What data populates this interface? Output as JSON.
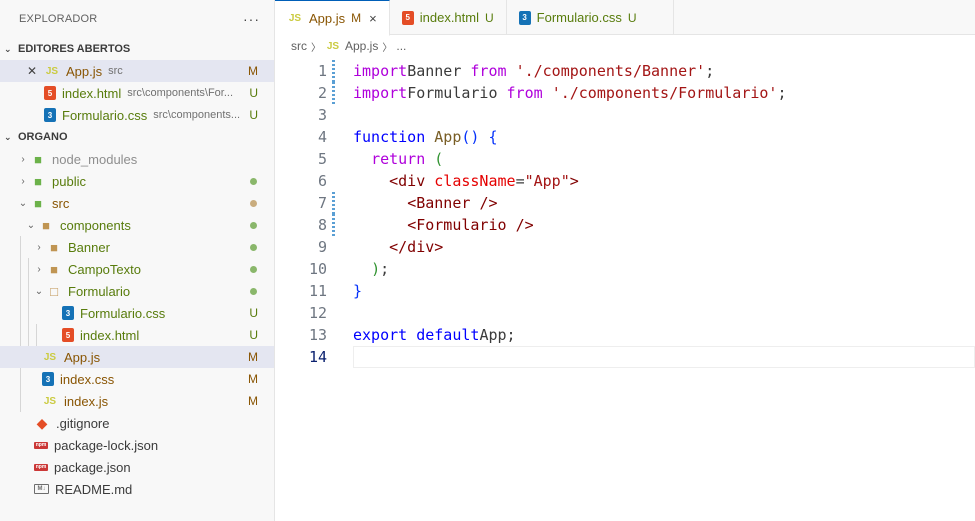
{
  "explorer": {
    "title": "EXPLORADOR",
    "more": "···",
    "open_editors": {
      "title": "EDITORES ABERTOS",
      "items": [
        {
          "name": "App.js",
          "desc": "src",
          "status": "M",
          "icon": "js-icon"
        },
        {
          "name": "index.html",
          "desc": "src\\components\\For...",
          "status": "U",
          "icon": "html-icon"
        },
        {
          "name": "Formulario.css",
          "desc": "src\\components...",
          "status": "U",
          "icon": "css-icon"
        }
      ]
    },
    "project": {
      "title": "ORGANO",
      "tree": [
        {
          "name": "node_modules",
          "kind": "folder"
        },
        {
          "name": "public",
          "kind": "folder"
        },
        {
          "name": "src",
          "kind": "folder"
        },
        {
          "name": "components",
          "kind": "folder"
        },
        {
          "name": "Banner",
          "kind": "folder"
        },
        {
          "name": "CampoTexto",
          "kind": "folder"
        },
        {
          "name": "Formulario",
          "kind": "folder"
        },
        {
          "name": "Formulario.css",
          "kind": "file",
          "status": "U"
        },
        {
          "name": "index.html",
          "kind": "file",
          "status": "U"
        },
        {
          "name": "App.js",
          "kind": "file",
          "status": "M"
        },
        {
          "name": "index.css",
          "kind": "file",
          "status": "M"
        },
        {
          "name": "index.js",
          "kind": "file",
          "status": "M"
        },
        {
          "name": ".gitignore",
          "kind": "file"
        },
        {
          "name": "package-lock.json",
          "kind": "file"
        },
        {
          "name": "package.json",
          "kind": "file"
        },
        {
          "name": "README.md",
          "kind": "file"
        }
      ]
    }
  },
  "tabs": [
    {
      "name": "App.js",
      "status": "M",
      "close": "×",
      "icon": "js-icon"
    },
    {
      "name": "index.html",
      "status": "U",
      "icon": "html-icon"
    },
    {
      "name": "Formulario.css",
      "status": "U",
      "icon": "css-icon"
    }
  ],
  "breadcrumb": {
    "folder": "src",
    "file": "App.js",
    "more": "..."
  },
  "code": {
    "line_numbers": [
      "1",
      "2",
      "3",
      "4",
      "5",
      "6",
      "7",
      "8",
      "9",
      "10",
      "11",
      "12",
      "13",
      "14"
    ],
    "lines": [
      [
        [
          "kw-ctl",
          "import"
        ],
        [
          "",
          "Banner "
        ],
        [
          "kw-ctl",
          "from"
        ],
        [
          "",
          ""
        ],
        [
          "str",
          "'./components/Banner'"
        ],
        [
          "",
          ";"
        ]
      ],
      [
        [
          "kw-ctl",
          "import"
        ],
        [
          "",
          "Formulario "
        ],
        [
          "kw-ctl",
          "from"
        ],
        [
          "",
          ""
        ],
        [
          "str",
          "'./components/Formulario'"
        ],
        [
          "",
          ";"
        ]
      ],
      [],
      [
        [
          "kw",
          "function"
        ],
        [
          "",
          ""
        ],
        [
          "fn",
          "App"
        ],
        [
          "pun",
          "()"
        ],
        [
          "",
          ""
        ],
        [
          "pun",
          "{"
        ]
      ],
      [
        [
          "",
          "  "
        ],
        [
          "kw-ctl",
          "return"
        ],
        [
          "",
          ""
        ],
        [
          "pun2",
          "("
        ]
      ],
      [
        [
          "",
          "    "
        ],
        [
          "tag",
          "<div"
        ],
        [
          "",
          ""
        ],
        [
          "attr",
          "className"
        ],
        [
          "",
          "="
        ],
        [
          "str",
          "\"App\""
        ],
        [
          "tag",
          ">"
        ]
      ],
      [
        [
          "",
          "      "
        ],
        [
          "tag",
          "<Banner"
        ],
        [
          "",
          ""
        ],
        [
          "tag",
          "/>"
        ]
      ],
      [
        [
          "",
          "      "
        ],
        [
          "tag",
          "<Formulario"
        ],
        [
          "",
          ""
        ],
        [
          "tag",
          "/>"
        ]
      ],
      [
        [
          "",
          "    "
        ],
        [
          "tag",
          "</div>"
        ]
      ],
      [
        [
          "",
          "  "
        ],
        [
          "pun2",
          ")"
        ],
        [
          "",
          ";"
        ]
      ],
      [
        [
          "pun",
          "}"
        ]
      ],
      [],
      [
        [
          "kw",
          "export"
        ],
        [
          "",
          ""
        ],
        [
          "kw",
          "default"
        ],
        [
          "",
          "App;"
        ]
      ],
      []
    ]
  },
  "colors": {
    "accent": "#005fb8",
    "modified": "#895503",
    "untracked": "#587c0c"
  }
}
